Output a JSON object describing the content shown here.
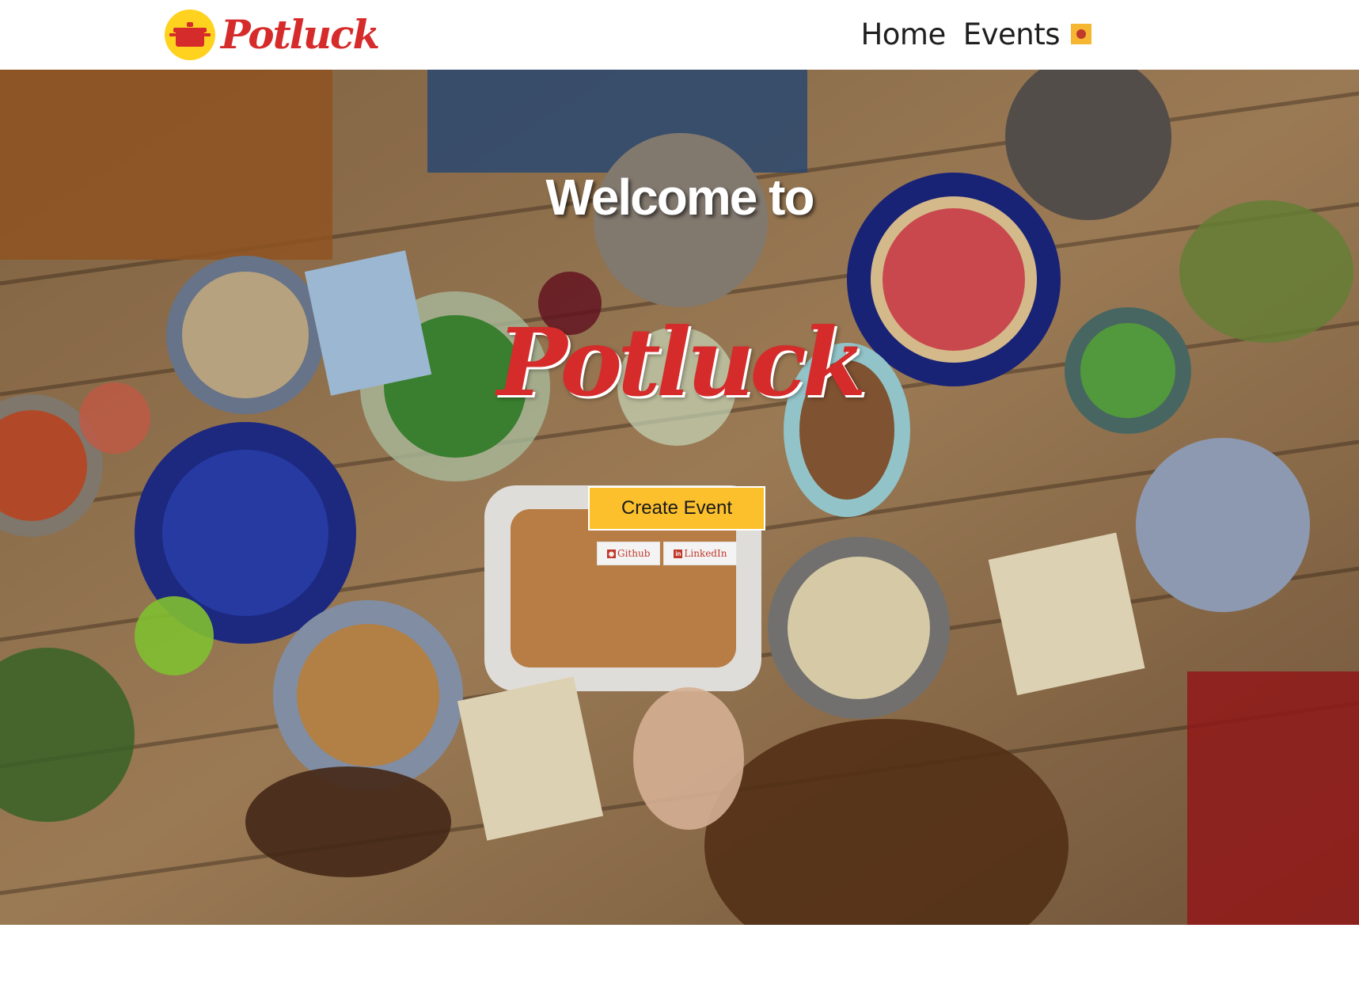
{
  "navbar": {
    "brand": "Potluck",
    "brand_icon": "cooking-pot-icon",
    "links": [
      {
        "label": "Home"
      },
      {
        "label": "Events"
      }
    ],
    "badge_icon": "notification-badge-icon"
  },
  "hero": {
    "title": "Welcome to",
    "brand": "Potluck",
    "background_image": "overhead photo of people sharing dishes around a wooden table",
    "create_button": "Create Event",
    "social": [
      {
        "label": "Github",
        "icon": "github-icon"
      },
      {
        "label": "LinkedIn",
        "icon": "linkedin-icon"
      }
    ]
  },
  "colors": {
    "brand_red": "#d62b2b",
    "accent_yellow": "#fcc02d",
    "nav_text": "#1f1f1f"
  }
}
